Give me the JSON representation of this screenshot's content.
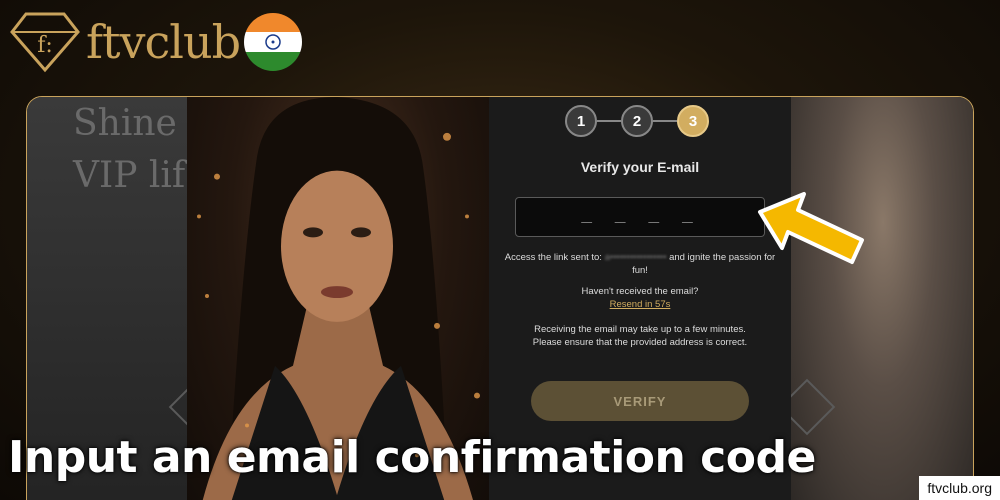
{
  "brand": {
    "name": "ftvclub",
    "logo_letter": "f:",
    "flag": "india-flag-icon"
  },
  "background": {
    "line1": "Shine",
    "line2": "VIP lif"
  },
  "steps": [
    "1",
    "2",
    "3"
  ],
  "active_step": 3,
  "form": {
    "title": "Verify your E-mail",
    "code_placeholder": "_ _ _ _",
    "access_prefix": "Access the link sent to:",
    "access_email_redacted": "a•••••••••••••••••",
    "access_suffix": "and ignite the passion for fun!",
    "not_received": "Haven't received the email?",
    "resend_label": "Resend in 57s",
    "note_line1": "Receiving the email may take up to a few minutes.",
    "note_line2": "Please ensure that the provided address is correct.",
    "verify_label": "VERIFY"
  },
  "caption": "Input an email confirmation code",
  "watermark": "ftvclub.org",
  "colors": {
    "gold": "#c9a35c",
    "arrow": "#f5b800"
  }
}
